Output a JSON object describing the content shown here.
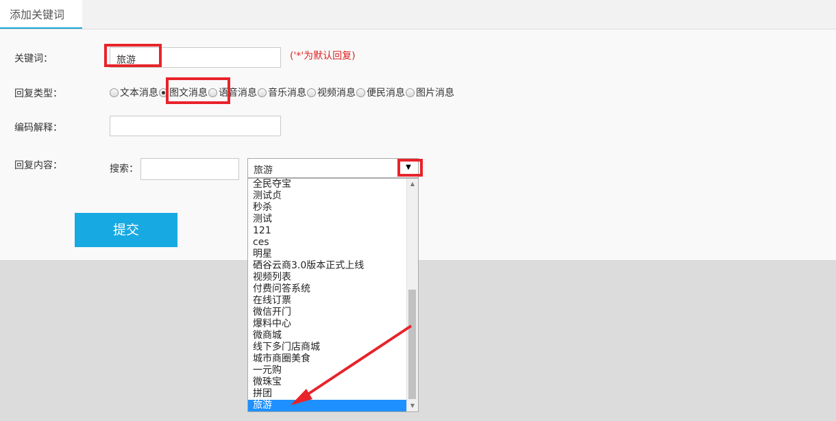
{
  "tab": {
    "title": "添加关键词"
  },
  "form": {
    "keyword": {
      "label": "关键词：",
      "value": "旅游",
      "hint": "('*'为默认回复)"
    },
    "reply_type": {
      "label": "回复类型：",
      "options": [
        {
          "label": "文本消息",
          "checked": false
        },
        {
          "label": "图文消息",
          "checked": true
        },
        {
          "label": "语音消息",
          "checked": false
        },
        {
          "label": "音乐消息",
          "checked": false
        },
        {
          "label": "视频消息",
          "checked": false
        },
        {
          "label": "便民消息",
          "checked": false
        },
        {
          "label": "图片消息",
          "checked": false
        }
      ]
    },
    "encoding": {
      "label": "编码解释：",
      "value": ""
    },
    "reply_content": {
      "label": "回复内容：",
      "search_label": "搜索：",
      "search_value": "",
      "selected": "旅游",
      "arrow_icon": "dropdown-arrow-icon",
      "options": [
        "全民夺宝",
        "测试贞",
        "秒杀",
        "测试",
        "121",
        "ces",
        "明星",
        "硒谷云商3.0版本正式上线",
        "视频列表",
        "付费问答系统",
        "在线订票",
        "微信开门",
        "爆料中心",
        "微商城",
        "线下多门店商城",
        "城市商圈美食",
        "一元购",
        "微珠宝",
        "拼团",
        "旅游"
      ]
    },
    "submit_label": "提交"
  },
  "colors": {
    "accent": "#17a9e1",
    "highlight": "#e8232a",
    "selected_option": "#1e90ff",
    "hint": "#e02020"
  }
}
